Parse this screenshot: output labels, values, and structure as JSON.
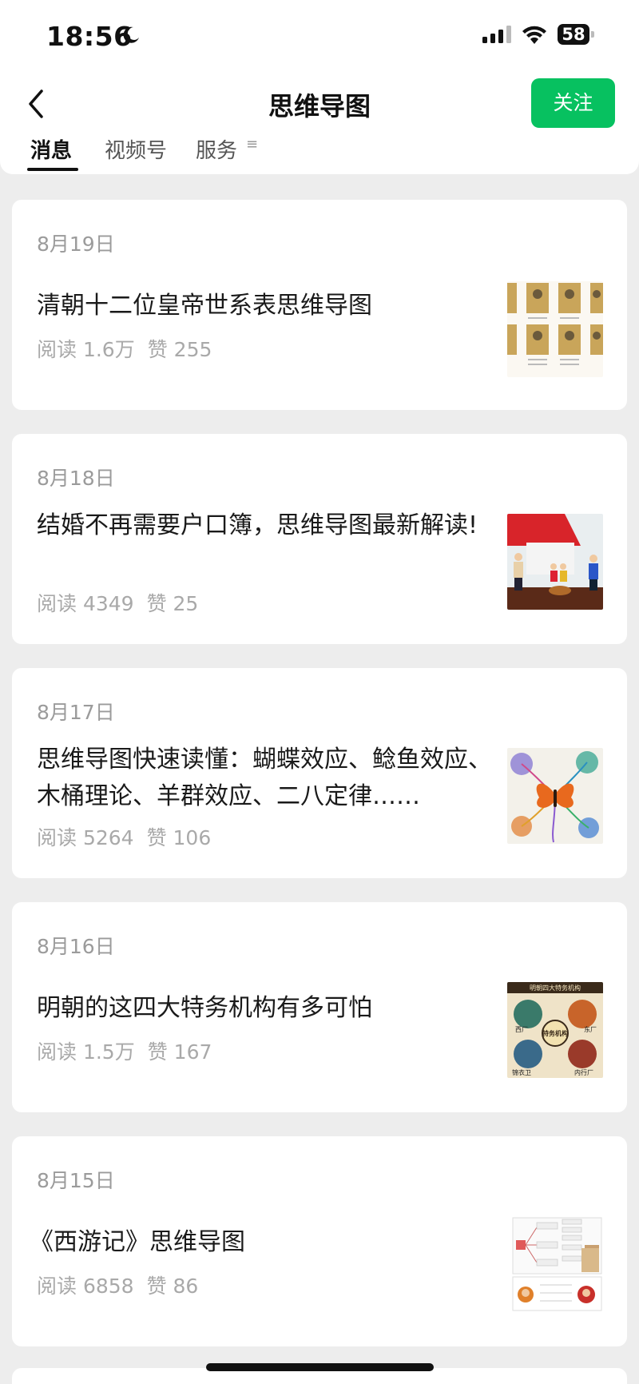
{
  "status": {
    "time": "18:56",
    "battery": "58"
  },
  "header": {
    "title": "思维导图",
    "follow_label": "关注"
  },
  "tabs": [
    {
      "label": "消息"
    },
    {
      "label": "视频号"
    },
    {
      "label": "服务"
    }
  ],
  "articles": [
    {
      "date": "8月19日",
      "title": "清朝十二位皇帝世系表思维导图",
      "reads": "阅读 1.6万",
      "likes": "赞 255"
    },
    {
      "date": "8月18日",
      "title": "结婚不再需要户口簿，思维导图最新解读!",
      "reads": "阅读 4349",
      "likes": "赞 25"
    },
    {
      "date": "8月17日",
      "title": "思维导图快速读懂：蝴蝶效应、鲶鱼效应、木桶理论、羊群效应、二八定律……",
      "reads": "阅读 5264",
      "likes": "赞 106"
    },
    {
      "date": "8月16日",
      "title": "明朝的这四大特务机构有多可怕",
      "reads": "阅读 1.5万",
      "likes": "赞 167",
      "thumb_text": {
        "heading": "明朝四大特务机构",
        "center": "特务机构",
        "west": "西厂",
        "east": "东厂",
        "bl": "锦衣卫",
        "br": "内行厂"
      }
    },
    {
      "date": "8月15日",
      "title": "《西游记》思维导图",
      "reads": "阅读 6858",
      "likes": "赞 86"
    }
  ],
  "colors": {
    "accent": "#07c160",
    "background": "#ededed"
  }
}
